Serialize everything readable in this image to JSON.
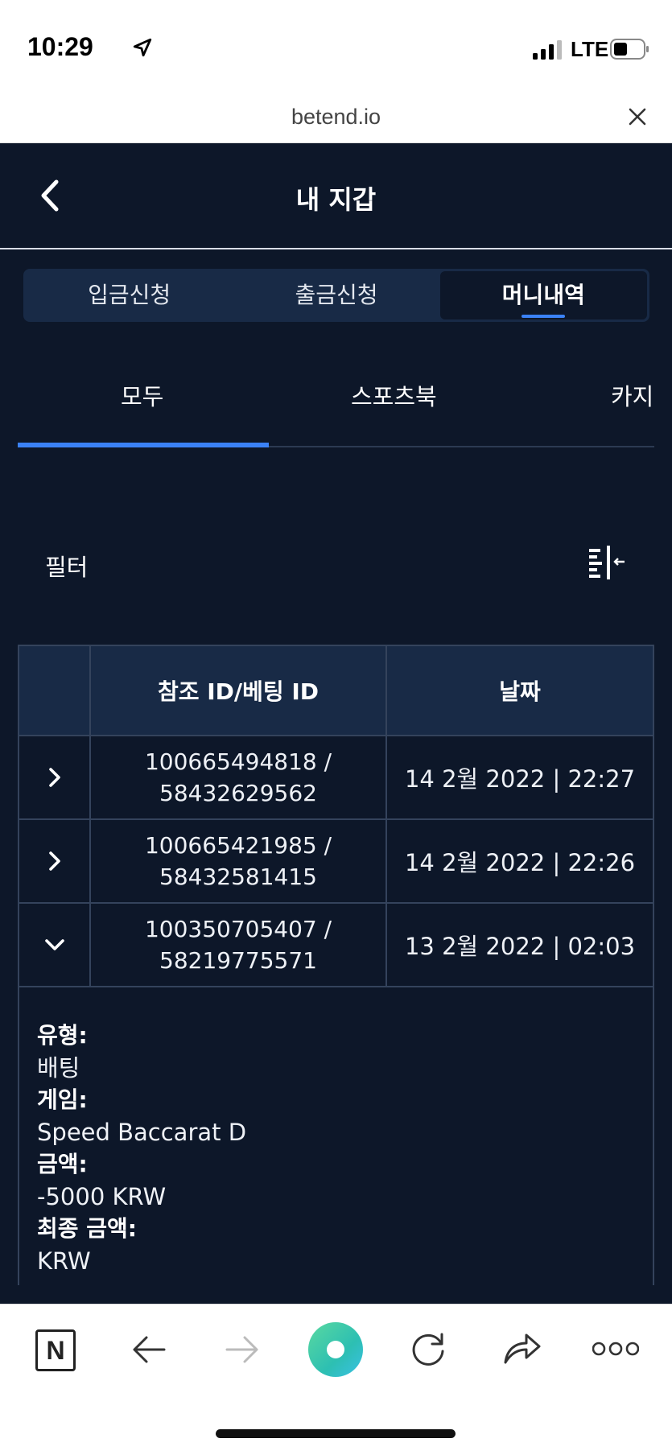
{
  "status_bar": {
    "time": "10:29",
    "network": "LTE"
  },
  "browser": {
    "url": "betend.io"
  },
  "header": {
    "title": "내 지갑"
  },
  "main_tabs": [
    {
      "label": "입금신청"
    },
    {
      "label": "출금신청"
    },
    {
      "label": "머니내역",
      "active": true
    }
  ],
  "sub_tabs": [
    {
      "label": "모두",
      "active": true
    },
    {
      "label": "스포츠북"
    },
    {
      "label": "카지"
    }
  ],
  "filter": {
    "label": "필터"
  },
  "table": {
    "headers": [
      "참조 ID/베팅 ID",
      "날짜"
    ],
    "rows": [
      {
        "ref_id": "100665494818 /",
        "bet_id": "58432629562",
        "date": "14 2월 2022 | 22:27",
        "expanded": false
      },
      {
        "ref_id": "100665421985 /",
        "bet_id": "58432581415",
        "date": "14 2월 2022 | 22:26",
        "expanded": false
      },
      {
        "ref_id": "100350705407 /",
        "bet_id": "58219775571",
        "date": "13 2월 2022 | 02:03",
        "expanded": true
      }
    ]
  },
  "details": {
    "type_label": "유형:",
    "type_value": "배팅",
    "game_label": "게임:",
    "game_value": "Speed Baccarat D",
    "amount_label": "금액:",
    "amount_value": "-5000 KRW",
    "final_label": "최종 금액:",
    "final_value": "KRW"
  },
  "toolbar": {
    "n_label": "N"
  },
  "colors": {
    "background": "#0d1729",
    "panel": "#182a46",
    "accent": "#3b82f6",
    "border": "#34435c"
  }
}
